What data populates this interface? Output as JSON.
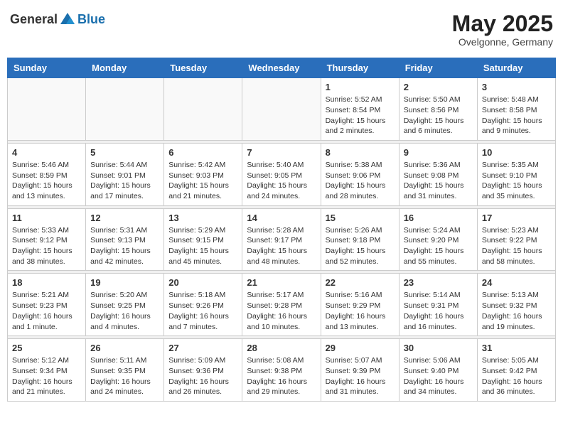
{
  "header": {
    "logo_general": "General",
    "logo_blue": "Blue",
    "month": "May 2025",
    "location": "Ovelgonne, Germany"
  },
  "weekdays": [
    "Sunday",
    "Monday",
    "Tuesday",
    "Wednesday",
    "Thursday",
    "Friday",
    "Saturday"
  ],
  "weeks": [
    [
      {
        "day": "",
        "info": ""
      },
      {
        "day": "",
        "info": ""
      },
      {
        "day": "",
        "info": ""
      },
      {
        "day": "",
        "info": ""
      },
      {
        "day": "1",
        "info": "Sunrise: 5:52 AM\nSunset: 8:54 PM\nDaylight: 15 hours\nand 2 minutes."
      },
      {
        "day": "2",
        "info": "Sunrise: 5:50 AM\nSunset: 8:56 PM\nDaylight: 15 hours\nand 6 minutes."
      },
      {
        "day": "3",
        "info": "Sunrise: 5:48 AM\nSunset: 8:58 PM\nDaylight: 15 hours\nand 9 minutes."
      }
    ],
    [
      {
        "day": "4",
        "info": "Sunrise: 5:46 AM\nSunset: 8:59 PM\nDaylight: 15 hours\nand 13 minutes."
      },
      {
        "day": "5",
        "info": "Sunrise: 5:44 AM\nSunset: 9:01 PM\nDaylight: 15 hours\nand 17 minutes."
      },
      {
        "day": "6",
        "info": "Sunrise: 5:42 AM\nSunset: 9:03 PM\nDaylight: 15 hours\nand 21 minutes."
      },
      {
        "day": "7",
        "info": "Sunrise: 5:40 AM\nSunset: 9:05 PM\nDaylight: 15 hours\nand 24 minutes."
      },
      {
        "day": "8",
        "info": "Sunrise: 5:38 AM\nSunset: 9:06 PM\nDaylight: 15 hours\nand 28 minutes."
      },
      {
        "day": "9",
        "info": "Sunrise: 5:36 AM\nSunset: 9:08 PM\nDaylight: 15 hours\nand 31 minutes."
      },
      {
        "day": "10",
        "info": "Sunrise: 5:35 AM\nSunset: 9:10 PM\nDaylight: 15 hours\nand 35 minutes."
      }
    ],
    [
      {
        "day": "11",
        "info": "Sunrise: 5:33 AM\nSunset: 9:12 PM\nDaylight: 15 hours\nand 38 minutes."
      },
      {
        "day": "12",
        "info": "Sunrise: 5:31 AM\nSunset: 9:13 PM\nDaylight: 15 hours\nand 42 minutes."
      },
      {
        "day": "13",
        "info": "Sunrise: 5:29 AM\nSunset: 9:15 PM\nDaylight: 15 hours\nand 45 minutes."
      },
      {
        "day": "14",
        "info": "Sunrise: 5:28 AM\nSunset: 9:17 PM\nDaylight: 15 hours\nand 48 minutes."
      },
      {
        "day": "15",
        "info": "Sunrise: 5:26 AM\nSunset: 9:18 PM\nDaylight: 15 hours\nand 52 minutes."
      },
      {
        "day": "16",
        "info": "Sunrise: 5:24 AM\nSunset: 9:20 PM\nDaylight: 15 hours\nand 55 minutes."
      },
      {
        "day": "17",
        "info": "Sunrise: 5:23 AM\nSunset: 9:22 PM\nDaylight: 15 hours\nand 58 minutes."
      }
    ],
    [
      {
        "day": "18",
        "info": "Sunrise: 5:21 AM\nSunset: 9:23 PM\nDaylight: 16 hours\nand 1 minute."
      },
      {
        "day": "19",
        "info": "Sunrise: 5:20 AM\nSunset: 9:25 PM\nDaylight: 16 hours\nand 4 minutes."
      },
      {
        "day": "20",
        "info": "Sunrise: 5:18 AM\nSunset: 9:26 PM\nDaylight: 16 hours\nand 7 minutes."
      },
      {
        "day": "21",
        "info": "Sunrise: 5:17 AM\nSunset: 9:28 PM\nDaylight: 16 hours\nand 10 minutes."
      },
      {
        "day": "22",
        "info": "Sunrise: 5:16 AM\nSunset: 9:29 PM\nDaylight: 16 hours\nand 13 minutes."
      },
      {
        "day": "23",
        "info": "Sunrise: 5:14 AM\nSunset: 9:31 PM\nDaylight: 16 hours\nand 16 minutes."
      },
      {
        "day": "24",
        "info": "Sunrise: 5:13 AM\nSunset: 9:32 PM\nDaylight: 16 hours\nand 19 minutes."
      }
    ],
    [
      {
        "day": "25",
        "info": "Sunrise: 5:12 AM\nSunset: 9:34 PM\nDaylight: 16 hours\nand 21 minutes."
      },
      {
        "day": "26",
        "info": "Sunrise: 5:11 AM\nSunset: 9:35 PM\nDaylight: 16 hours\nand 24 minutes."
      },
      {
        "day": "27",
        "info": "Sunrise: 5:09 AM\nSunset: 9:36 PM\nDaylight: 16 hours\nand 26 minutes."
      },
      {
        "day": "28",
        "info": "Sunrise: 5:08 AM\nSunset: 9:38 PM\nDaylight: 16 hours\nand 29 minutes."
      },
      {
        "day": "29",
        "info": "Sunrise: 5:07 AM\nSunset: 9:39 PM\nDaylight: 16 hours\nand 31 minutes."
      },
      {
        "day": "30",
        "info": "Sunrise: 5:06 AM\nSunset: 9:40 PM\nDaylight: 16 hours\nand 34 minutes."
      },
      {
        "day": "31",
        "info": "Sunrise: 5:05 AM\nSunset: 9:42 PM\nDaylight: 16 hours\nand 36 minutes."
      }
    ]
  ]
}
